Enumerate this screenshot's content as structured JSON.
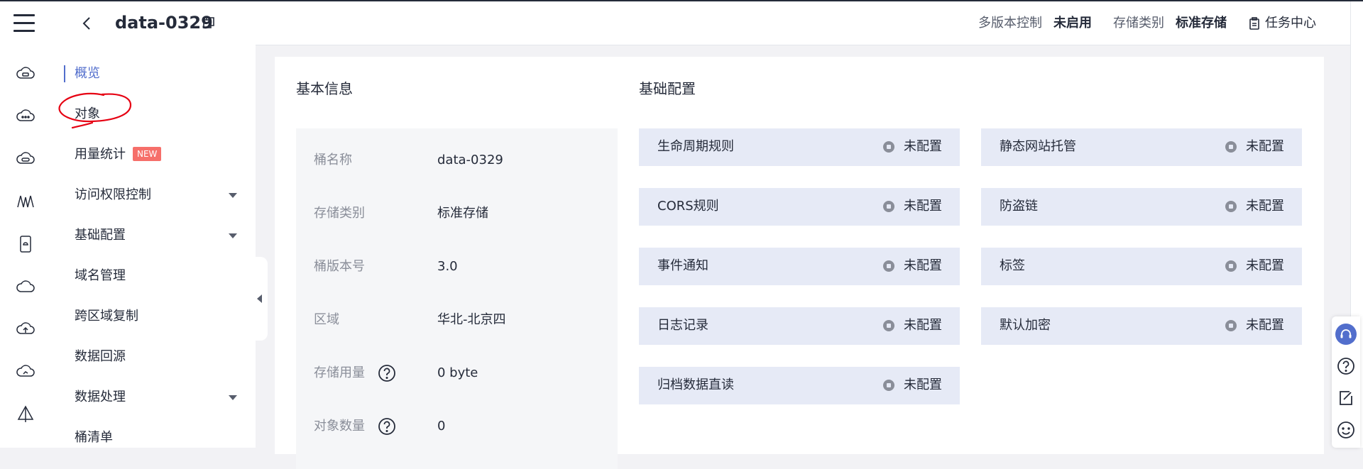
{
  "header": {
    "bucket_name": "data-0329",
    "versioning_label": "多版本控制",
    "versioning_value": "未启用",
    "storage_class_label": "存储类别",
    "storage_class_value": "标准存储",
    "task_center": "任务中心"
  },
  "nav": {
    "items": [
      {
        "label": "概览",
        "active": true
      },
      {
        "label": "对象"
      },
      {
        "label": "用量统计",
        "badge": "NEW"
      },
      {
        "label": "访问权限控制",
        "expandable": true
      },
      {
        "label": "基础配置",
        "expandable": true
      },
      {
        "label": "域名管理"
      },
      {
        "label": "跨区域复制"
      },
      {
        "label": "数据回源"
      },
      {
        "label": "数据处理",
        "expandable": true
      },
      {
        "label": "桶清单"
      }
    ]
  },
  "basic_info": {
    "title": "基本信息",
    "rows": [
      {
        "label": "桶名称",
        "value": "data-0329"
      },
      {
        "label": "存储类别",
        "value": "标准存储"
      },
      {
        "label": "桶版本号",
        "value": "3.0"
      },
      {
        "label": "区域",
        "value": "华北-北京四"
      },
      {
        "label": "存储用量",
        "value": "0 byte",
        "help": true
      },
      {
        "label": "对象数量",
        "value": "0",
        "help": true
      }
    ]
  },
  "basic_config": {
    "title": "基础配置",
    "items": [
      {
        "name": "生命周期规则",
        "status": "未配置"
      },
      {
        "name": "静态网站托管",
        "status": "未配置"
      },
      {
        "name": "CORS规则",
        "status": "未配置"
      },
      {
        "name": "防盗链",
        "status": "未配置"
      },
      {
        "name": "事件通知",
        "status": "未配置"
      },
      {
        "name": "标签",
        "status": "未配置"
      },
      {
        "name": "日志记录",
        "status": "未配置"
      },
      {
        "name": "默认加密",
        "status": "未配置"
      },
      {
        "name": "归档数据直读",
        "status": "未配置"
      }
    ]
  },
  "colors": {
    "accent": "#526ecc",
    "badge": "#f66f6a",
    "annotation": "#e60012",
    "config_bg": "#e6eaf6"
  },
  "icons": {
    "rail": [
      "cloud-server-icon",
      "cloud-dots-icon",
      "cloud-storage-icon",
      "waveform-icon",
      "mobile-icon",
      "cloud-icon",
      "cloud-upload-icon",
      "cloud-network-icon",
      "triangle-network-icon"
    ],
    "tools": [
      "headset-icon",
      "help-icon",
      "edit-icon",
      "smile-icon"
    ]
  }
}
